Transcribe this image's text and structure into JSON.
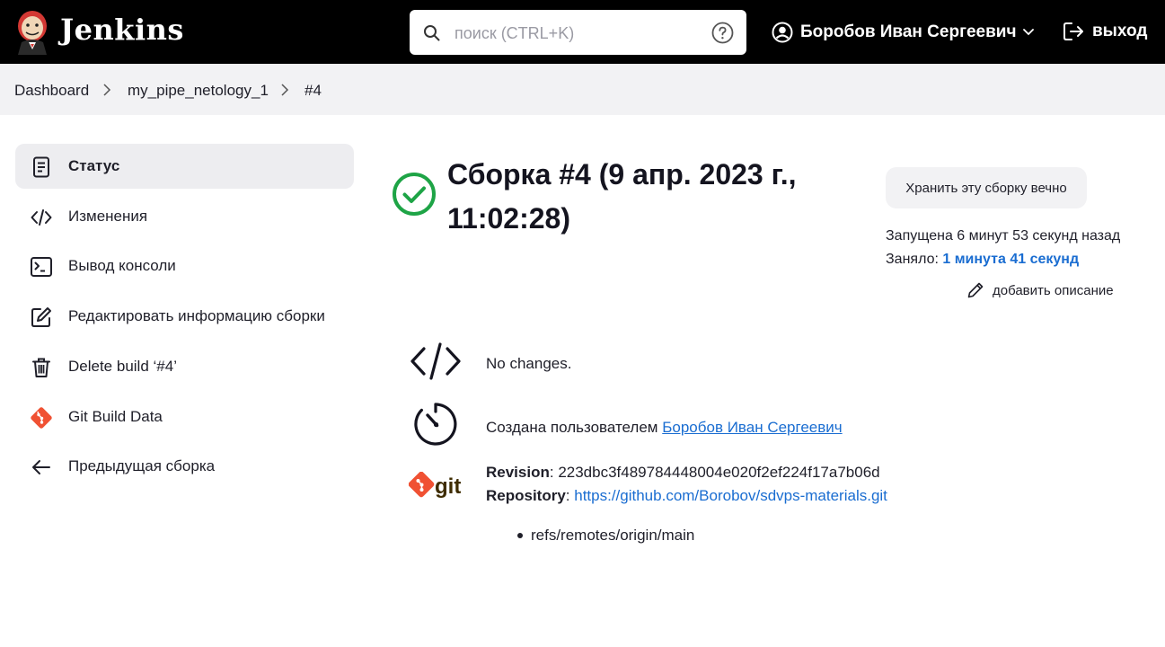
{
  "header": {
    "brand": "Jenkins",
    "search_placeholder": "поиск (CTRL+K)",
    "user_name": "Боробов Иван Сергеевич",
    "logout_label": "выход"
  },
  "breadcrumb": [
    "Dashboard",
    "my_pipe_netology_1",
    "#4"
  ],
  "sidebar": {
    "items": [
      {
        "label": "Статус",
        "icon": "document-icon",
        "active": true
      },
      {
        "label": "Изменения",
        "icon": "code-icon"
      },
      {
        "label": "Вывод консоли",
        "icon": "terminal-icon"
      },
      {
        "label": "Редактировать информацию сборки",
        "icon": "edit-icon"
      },
      {
        "label": "Delete build ‘#4’",
        "icon": "trash-icon"
      },
      {
        "label": "Git Build Data",
        "icon": "git-icon"
      },
      {
        "label": "Предыдущая сборка",
        "icon": "arrow-left-icon"
      }
    ]
  },
  "build": {
    "title": "Сборка #4 (9 апр. 2023 г., 11:02:28)",
    "status": "success",
    "keep_label": "Хранить эту сборку вечно",
    "started": "Запущена 6 минут 53 секунд назад",
    "took_label": "Заняло:",
    "took_value": "1 минута 41 секунд",
    "add_description": "добавить описание"
  },
  "changes": {
    "text": "No changes."
  },
  "cause": {
    "prefix": "Создана пользователем",
    "user": "Боробов Иван Сергеевич"
  },
  "git": {
    "revision_label": "Revision",
    "revision": "223dbc3f489784448004e020f2ef224f17a7b06d",
    "repository_label": "Repository",
    "repository": "https://github.com/Borobov/sdvps-materials.git",
    "branch": "refs/remotes/origin/main",
    "logo_text": "git"
  },
  "colors": {
    "success": "#1ea446",
    "link": "#1a6dd1",
    "git_orange": "#f05133"
  }
}
